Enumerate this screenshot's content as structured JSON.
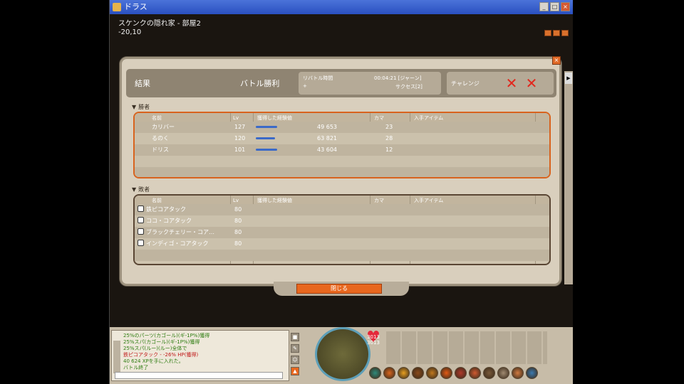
{
  "window": {
    "title": "ドラス",
    "minimize": "_",
    "maximize": "□",
    "close": "×"
  },
  "map": {
    "name": "スケンクの隠れ家 - 部屋2",
    "coords": "-20,10"
  },
  "dialog": {
    "result_label": "結果",
    "battle_title": "バトル勝利",
    "info_left_top": "リバトル時間",
    "info_right_top": "00:04:21 [ジャーン]",
    "info_left_bottom": "+",
    "info_right_bottom": "サクセス[2]",
    "challenge_label": "チャレンジ",
    "winners_label": "勝者",
    "losers_label": "敗者",
    "columns": {
      "name": "名前",
      "level": "Lv",
      "xp": "獲得した経験値",
      "kama": "カマ",
      "items": "入手アイテム"
    },
    "winners": [
      {
        "name": "カリバー",
        "level": "127",
        "xp": "49 653",
        "kama": "23",
        "bar": 0.55
      },
      {
        "name": "るのく",
        "level": "120",
        "xp": "63 821",
        "kama": "28",
        "bar": 0.5
      },
      {
        "name": "ドリス",
        "level": "101",
        "xp": "43 604",
        "kama": "12",
        "bar": 0.55
      }
    ],
    "losers": [
      {
        "name": "鉄ピコアタック",
        "level": "80"
      },
      {
        "name": "ココ・コアタック",
        "level": "80"
      },
      {
        "name": "ブラックチェリー・コア…",
        "level": "80"
      },
      {
        "name": "インディゴ・コアタック",
        "level": "80"
      }
    ],
    "close_button": "閉じる"
  },
  "chat": {
    "lines": [
      {
        "text": "25%のパーツ(カゴール)(ギ-1P%)獲得",
        "color": "green"
      },
      {
        "text": "25%スパ(カゴール)(ギ-1P%)獲得",
        "color": "green"
      },
      {
        "text": "25%スパ(ルー)(ルー)全体で",
        "color": "green"
      },
      {
        "text": "鉄ピコアタック - -26% HP(獲得)",
        "color": "red"
      },
      {
        "text": "40 624 XPを手に入れた。",
        "color": "green"
      },
      {
        "text": "バトル終了",
        "color": "green"
      }
    ],
    "input_value": ""
  },
  "hud": {
    "hp": "3013 3013"
  },
  "colors": {
    "accent": "#e8671e",
    "dialog_bg": "#d9cfbd"
  }
}
